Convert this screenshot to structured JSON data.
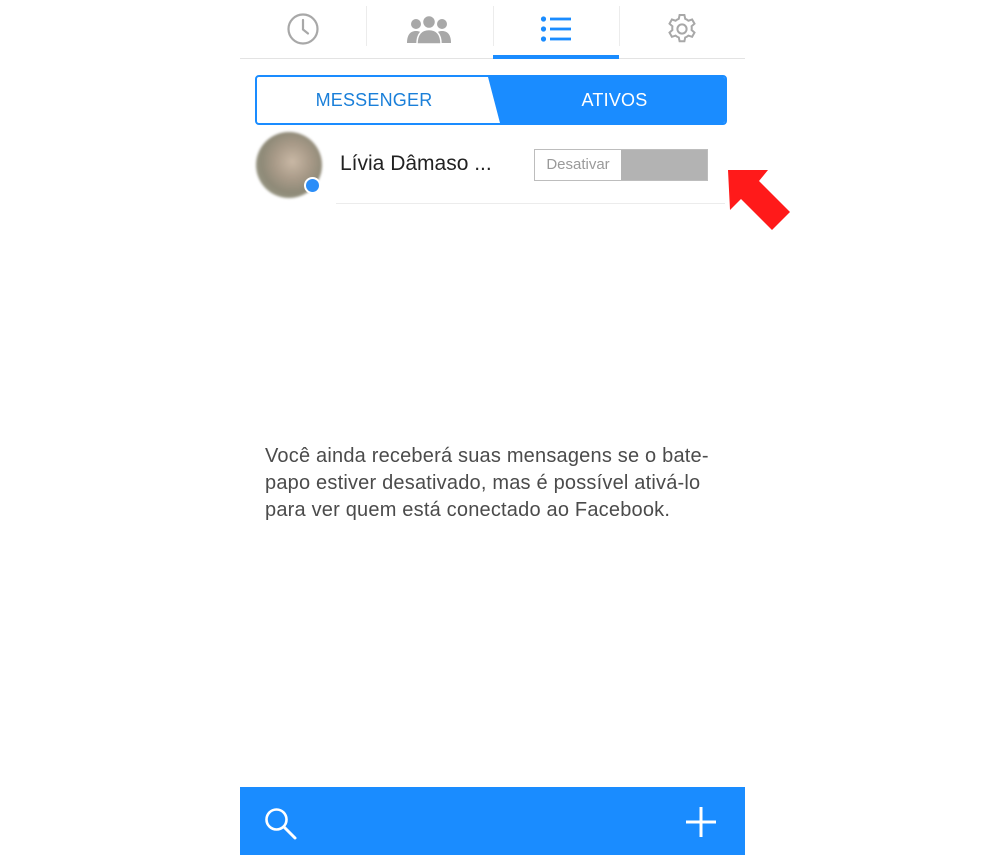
{
  "tabs": [
    {
      "icon": "clock-icon",
      "active": false
    },
    {
      "icon": "people-icon",
      "active": false
    },
    {
      "icon": "list-icon",
      "active": true
    },
    {
      "icon": "gear-icon",
      "active": false
    }
  ],
  "segment": {
    "left_label": "MESSENGER",
    "right_label": "ATIVOS",
    "selected": "ATIVOS"
  },
  "contact": {
    "name": "Lívia Dâmaso ...",
    "toggle_label": "Desativar"
  },
  "info_text": "Você ainda receberá suas mensagens se o bate-papo estiver desativado, mas é possível ativá-lo para ver quem está conectado ao Facebook.",
  "bottombar": {
    "left_icon": "search-icon",
    "right_icon": "plus-icon"
  },
  "colors": {
    "accent": "#1a8cff",
    "annotation": "#ff1a1a",
    "toggle_off": "#b3b3b3"
  }
}
